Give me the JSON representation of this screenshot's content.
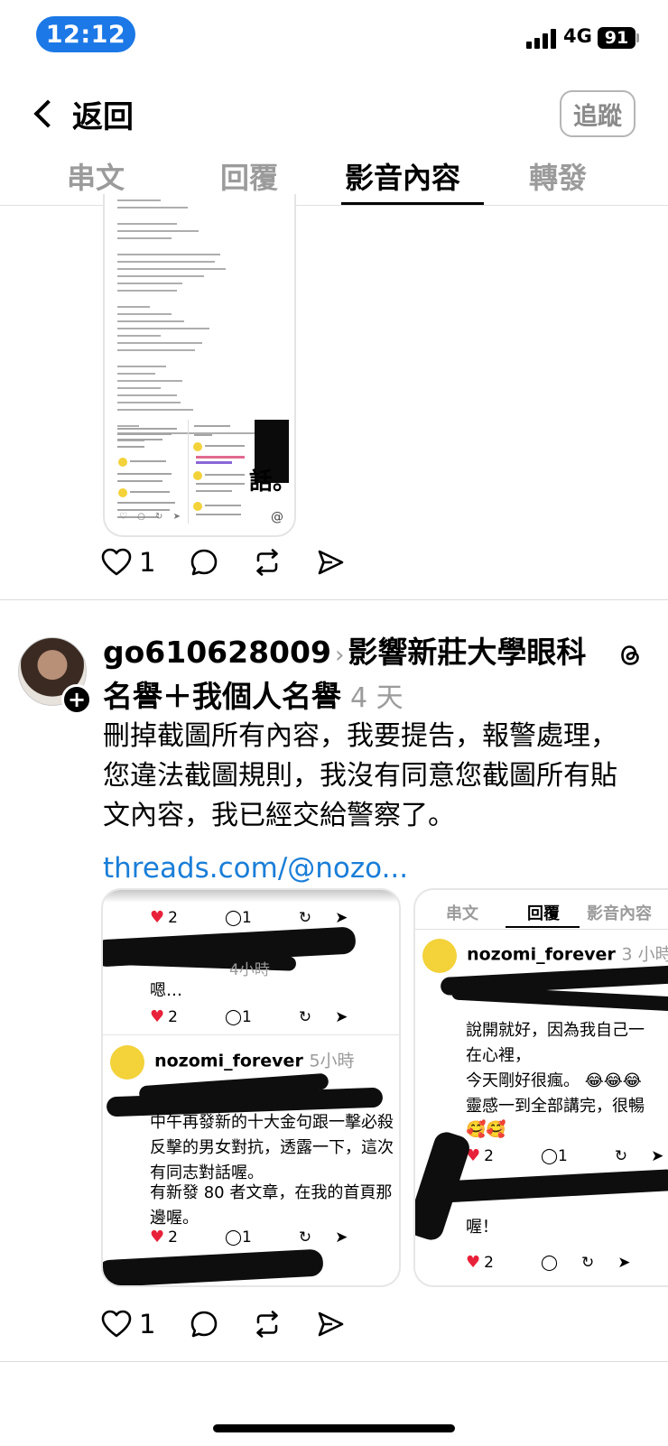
{
  "status_bar": {
    "time": "12:12",
    "network": "4G",
    "battery": "91"
  },
  "nav": {
    "back_label": "返回",
    "follow_label": "追蹤"
  },
  "tabs": [
    {
      "label": "串文"
    },
    {
      "label": "回覆"
    },
    {
      "label": "影音內容"
    },
    {
      "label": "轉發"
    }
  ],
  "post1": {
    "shot_text": "話。",
    "like_count": "1"
  },
  "post2": {
    "username": "go610628009",
    "topic": "影響新莊大學眼科名譽＋我個人名譽",
    "time_ago": "4 天",
    "body": "刪掉截圖所有內容，我要提告，報警處理，您違法截圖規則，我沒有同意您截圖所有貼文內容，我已經交給警察了。",
    "link": "threads.com/@nozo...",
    "like_count": "1",
    "card1": {
      "r1": {
        "likes": "2",
        "comments": "1"
      },
      "time_b": "4小時",
      "text_b": "嗯…",
      "r2": {
        "likes": "2",
        "comments": "1"
      },
      "username": "nozomi_forever",
      "time": "5小時",
      "text1": "中午再發新的十大金句跟一擊必殺反擊的男女對抗，透露一下，這次有同志對話喔。",
      "text2": "有新發 80 者文章，在我的首頁那邊喔。",
      "r3": {
        "likes": "2",
        "comments": "1"
      }
    },
    "card2": {
      "tabs": [
        "串文",
        "回覆",
        "影音內容"
      ],
      "username": "nozomi_forever",
      "time": "3 小時",
      "text1": "說開就好，因為我自己一",
      "text2": "在心裡，",
      "text3": "今天剛好很瘋。",
      "text4": "靈感一到全部講完，很暢",
      "r1": {
        "likes": "2",
        "comments": "1"
      },
      "text5": "喔！",
      "r2": {
        "likes": "2"
      }
    }
  }
}
